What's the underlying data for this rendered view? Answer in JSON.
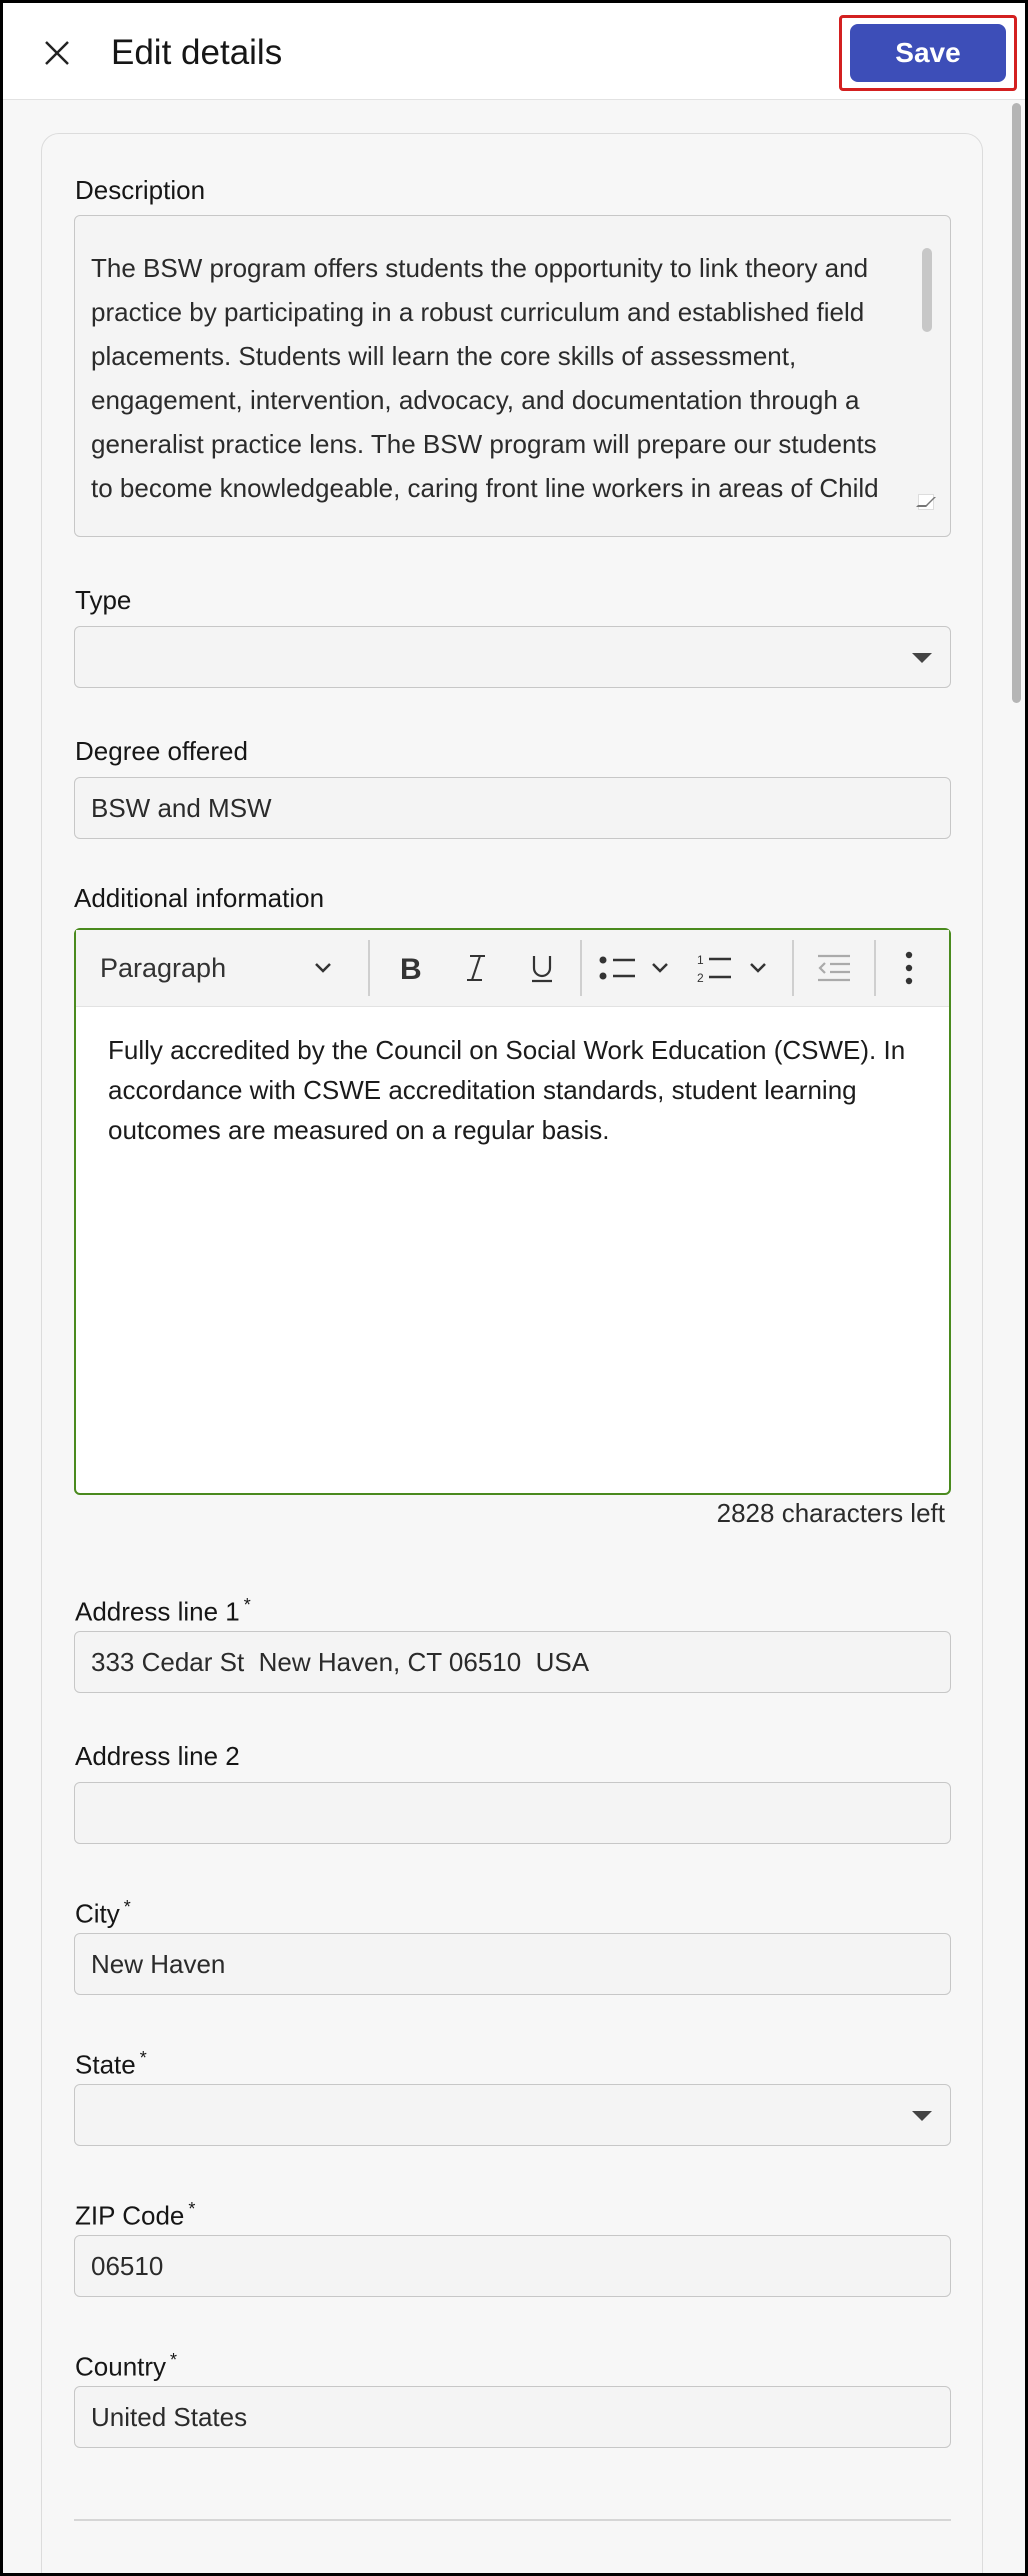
{
  "header": {
    "title": "Edit details",
    "save_label": "Save",
    "close_icon": "close-icon"
  },
  "form": {
    "description": {
      "label": "Description",
      "value": "The BSW program offers students the opportunity to link theory and practice by participating in a robust curriculum and established field placements. Students will learn the core skills of assessment, engagement, intervention, advocacy, and documentation through a generalist practice lens. The BSW program will prepare our students to become knowledgeable, caring front line workers in areas of Child"
    },
    "type": {
      "label": "Type",
      "value": ""
    },
    "degree": {
      "label": "Degree offered",
      "value": "BSW and MSW"
    },
    "additional": {
      "label": "Additional information",
      "toolbar": {
        "paragraph": "Paragraph"
      },
      "content": "Fully accredited by the Council on Social Work Education (CSWE). In accordance with CSWE accreditation standards, student learning outcomes are measured on a regular basis.",
      "counter": "2828 characters left"
    },
    "address1": {
      "label": "Address line 1",
      "required": "*",
      "value": "333 Cedar St  New Haven, CT 06510  USA"
    },
    "address2": {
      "label": "Address line 2",
      "value": ""
    },
    "city": {
      "label": "City",
      "required": "*",
      "value": "New Haven"
    },
    "state": {
      "label": "State",
      "required": "*",
      "value": ""
    },
    "zip": {
      "label": "ZIP Code",
      "required": "*",
      "value": "06510"
    },
    "country": {
      "label": "Country",
      "required": "*",
      "value": "United States"
    }
  },
  "colors": {
    "primary": "#3d4eb8",
    "focus": "#4a8a1e",
    "highlight": "#d32020"
  }
}
